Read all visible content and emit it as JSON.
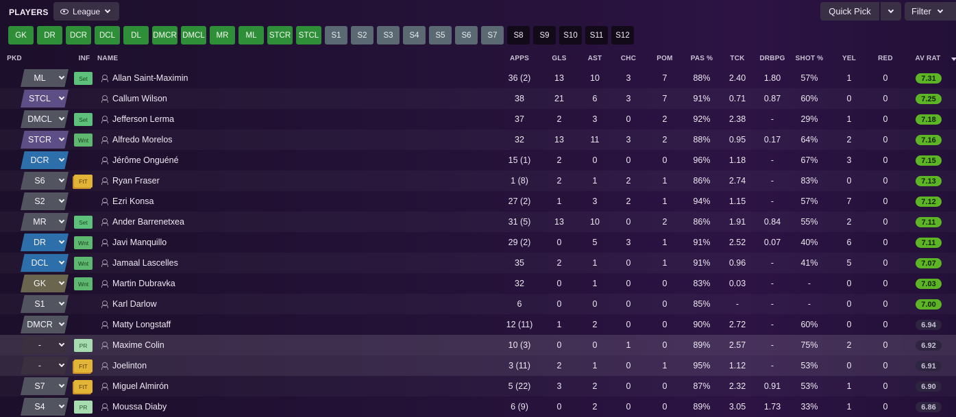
{
  "header": {
    "title": "PLAYERS",
    "view": "League",
    "quick_pick": "Quick Pick",
    "filter": "Filter"
  },
  "position_chips": [
    {
      "label": "GK",
      "style": "green"
    },
    {
      "label": "DR",
      "style": "green"
    },
    {
      "label": "DCR",
      "style": "green"
    },
    {
      "label": "DCL",
      "style": "green"
    },
    {
      "label": "DL",
      "style": "green"
    },
    {
      "label": "DMCR",
      "style": "green"
    },
    {
      "label": "DMCL",
      "style": "green"
    },
    {
      "label": "MR",
      "style": "green"
    },
    {
      "label": "ML",
      "style": "green"
    },
    {
      "label": "STCR",
      "style": "green"
    },
    {
      "label": "STCL",
      "style": "green"
    },
    {
      "label": "S1",
      "style": "grey"
    },
    {
      "label": "S2",
      "style": "grey"
    },
    {
      "label": "S3",
      "style": "grey"
    },
    {
      "label": "S4",
      "style": "grey"
    },
    {
      "label": "S5",
      "style": "grey"
    },
    {
      "label": "S6",
      "style": "grey"
    },
    {
      "label": "S7",
      "style": "grey"
    },
    {
      "label": "S8",
      "style": "dark"
    },
    {
      "label": "S9",
      "style": "dark"
    },
    {
      "label": "S10",
      "style": "dark"
    },
    {
      "label": "S11",
      "style": "dark"
    },
    {
      "label": "S12",
      "style": "dark"
    }
  ],
  "columns": [
    "PKD",
    "INF",
    "NAME",
    "APPS",
    "GLS",
    "AST",
    "CHC",
    "POM",
    "PAS %",
    "TCK",
    "DRBPG",
    "SHOT %",
    "YEL",
    "RED",
    "AV RAT"
  ],
  "rows": [
    {
      "pkd": "ML",
      "pkd_color": "grey",
      "inf": "Set",
      "name": "Allan Saint-Maximin",
      "apps": "36 (2)",
      "gls": "13",
      "ast": "10",
      "chc": "3",
      "pom": "7",
      "pas": "88%",
      "tck": "2.40",
      "drbpg": "1.80",
      "shot": "57%",
      "yel": "1",
      "red": "0",
      "rat": "7.31"
    },
    {
      "pkd": "STCL",
      "pkd_color": "purple",
      "inf": "",
      "name": "Callum Wilson",
      "apps": "38",
      "gls": "21",
      "ast": "6",
      "chc": "3",
      "pom": "7",
      "pas": "91%",
      "tck": "0.71",
      "drbpg": "0.87",
      "shot": "60%",
      "yel": "0",
      "red": "0",
      "rat": "7.25"
    },
    {
      "pkd": "DMCL",
      "pkd_color": "grey",
      "inf": "Set",
      "name": "Jefferson Lerma",
      "apps": "37",
      "gls": "2",
      "ast": "3",
      "chc": "0",
      "pom": "2",
      "pas": "92%",
      "tck": "2.38",
      "drbpg": "-",
      "shot": "29%",
      "yel": "1",
      "red": "0",
      "rat": "7.18"
    },
    {
      "pkd": "STCR",
      "pkd_color": "purple",
      "inf": "Wnt",
      "name": "Alfredo Morelos",
      "apps": "32",
      "gls": "13",
      "ast": "11",
      "chc": "3",
      "pom": "2",
      "pas": "88%",
      "tck": "0.95",
      "drbpg": "0.17",
      "shot": "64%",
      "yel": "2",
      "red": "0",
      "rat": "7.16"
    },
    {
      "pkd": "DCR",
      "pkd_color": "blue",
      "inf": "",
      "name": "Jérôme Onguéné",
      "apps": "15 (1)",
      "gls": "2",
      "ast": "0",
      "chc": "0",
      "pom": "0",
      "pas": "96%",
      "tck": "1.18",
      "drbpg": "-",
      "shot": "67%",
      "yel": "3",
      "red": "0",
      "rat": "7.15"
    },
    {
      "pkd": "S6",
      "pkd_color": "grey",
      "inf": "FtT",
      "name": "Ryan Fraser",
      "apps": "1 (8)",
      "gls": "2",
      "ast": "1",
      "chc": "2",
      "pom": "1",
      "pas": "86%",
      "tck": "2.74",
      "drbpg": "-",
      "shot": "83%",
      "yel": "0",
      "red": "0",
      "rat": "7.13"
    },
    {
      "pkd": "S2",
      "pkd_color": "grey",
      "inf": "",
      "name": "Ezri Konsa",
      "apps": "27 (2)",
      "gls": "1",
      "ast": "3",
      "chc": "2",
      "pom": "1",
      "pas": "94%",
      "tck": "1.15",
      "drbpg": "-",
      "shot": "57%",
      "yel": "7",
      "red": "0",
      "rat": "7.12"
    },
    {
      "pkd": "MR",
      "pkd_color": "grey",
      "inf": "Set",
      "name": "Ander Barrenetxea",
      "apps": "31 (5)",
      "gls": "13",
      "ast": "10",
      "chc": "0",
      "pom": "2",
      "pas": "86%",
      "tck": "1.91",
      "drbpg": "0.84",
      "shot": "55%",
      "yel": "2",
      "red": "0",
      "rat": "7.11"
    },
    {
      "pkd": "DR",
      "pkd_color": "blue",
      "inf": "Wnt",
      "name": "Javi Manquillo",
      "apps": "29 (2)",
      "gls": "0",
      "ast": "5",
      "chc": "3",
      "pom": "1",
      "pas": "91%",
      "tck": "2.52",
      "drbpg": "0.07",
      "shot": "40%",
      "yel": "6",
      "red": "0",
      "rat": "7.11"
    },
    {
      "pkd": "DCL",
      "pkd_color": "blue",
      "inf": "Wnt",
      "name": "Jamaal Lascelles",
      "apps": "35",
      "gls": "2",
      "ast": "1",
      "chc": "0",
      "pom": "1",
      "pas": "91%",
      "tck": "0.96",
      "drbpg": "-",
      "shot": "41%",
      "yel": "5",
      "red": "0",
      "rat": "7.07"
    },
    {
      "pkd": "GK",
      "pkd_color": "olive",
      "inf": "Wnt",
      "name": "Martin Dubravka",
      "apps": "32",
      "gls": "0",
      "ast": "1",
      "chc": "0",
      "pom": "0",
      "pas": "83%",
      "tck": "0.03",
      "drbpg": "-",
      "shot": "-",
      "yel": "0",
      "red": "0",
      "rat": "7.03"
    },
    {
      "pkd": "S1",
      "pkd_color": "grey",
      "inf": "",
      "name": "Karl Darlow",
      "apps": "6",
      "gls": "0",
      "ast": "0",
      "chc": "0",
      "pom": "0",
      "pas": "85%",
      "tck": "-",
      "drbpg": "-",
      "shot": "-",
      "yel": "0",
      "red": "0",
      "rat": "7.00"
    },
    {
      "pkd": "DMCR",
      "pkd_color": "grey",
      "inf": "",
      "name": "Matty Longstaff",
      "apps": "12 (11)",
      "gls": "1",
      "ast": "2",
      "chc": "0",
      "pom": "0",
      "pas": "90%",
      "tck": "2.72",
      "drbpg": "-",
      "shot": "60%",
      "yel": "0",
      "red": "0",
      "rat": "6.94"
    },
    {
      "pkd": "-",
      "pkd_color": "blank",
      "inf": "PR",
      "name": "Maxime Colin",
      "apps": "10 (3)",
      "gls": "0",
      "ast": "0",
      "chc": "1",
      "pom": "0",
      "pas": "89%",
      "tck": "2.57",
      "drbpg": "-",
      "shot": "75%",
      "yel": "2",
      "red": "0",
      "rat": "6.92"
    },
    {
      "pkd": "-",
      "pkd_color": "blank",
      "inf": "FtT",
      "name": "Joelinton",
      "apps": "3 (11)",
      "gls": "2",
      "ast": "1",
      "chc": "0",
      "pom": "1",
      "pas": "95%",
      "tck": "1.12",
      "drbpg": "-",
      "shot": "53%",
      "yel": "0",
      "red": "0",
      "rat": "6.91"
    },
    {
      "pkd": "S7",
      "pkd_color": "grey",
      "inf": "FtT",
      "name": "Miguel Almirón",
      "apps": "5 (22)",
      "gls": "3",
      "ast": "2",
      "chc": "0",
      "pom": "0",
      "pas": "87%",
      "tck": "2.32",
      "drbpg": "0.91",
      "shot": "53%",
      "yel": "1",
      "red": "0",
      "rat": "6.90"
    },
    {
      "pkd": "S4",
      "pkd_color": "grey",
      "inf": "PR",
      "name": "Moussa Diaby",
      "apps": "6 (9)",
      "gls": "0",
      "ast": "2",
      "chc": "0",
      "pom": "0",
      "pas": "89%",
      "tck": "3.05",
      "drbpg": "1.73",
      "shot": "33%",
      "yel": "1",
      "red": "0",
      "rat": "6.86"
    }
  ]
}
